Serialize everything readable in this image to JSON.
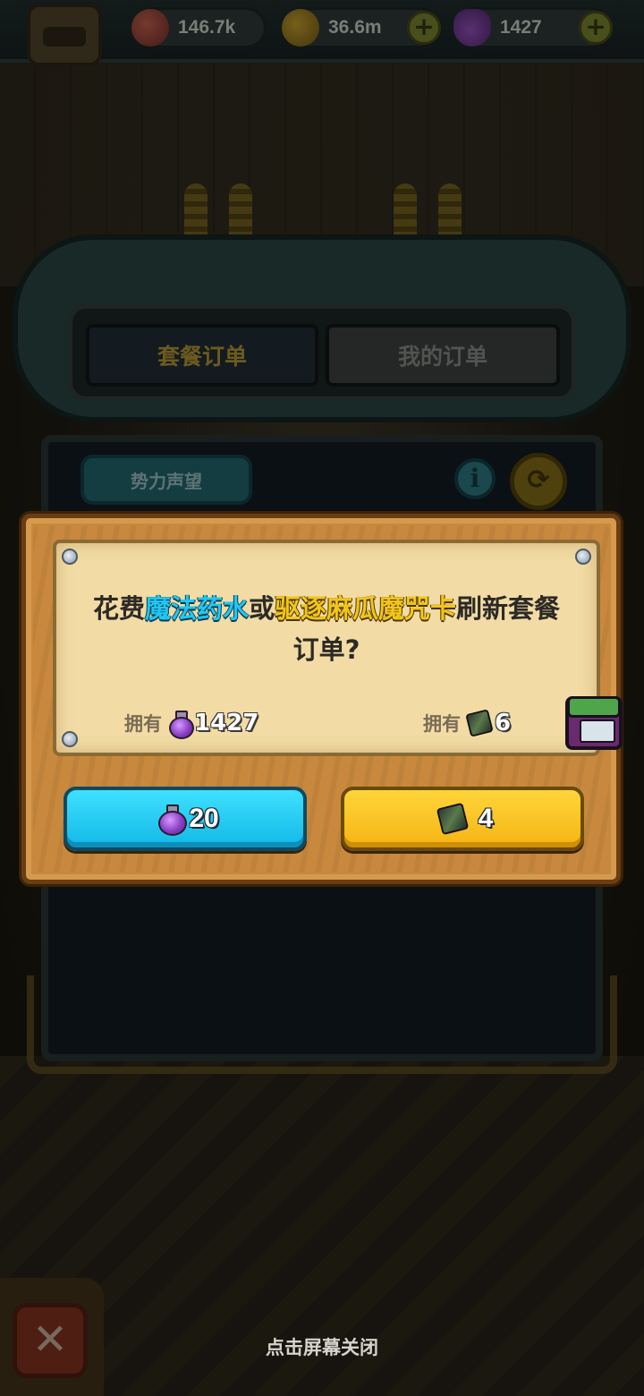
{
  "topbar": {
    "gems": "146.7k",
    "coins": "36.6m",
    "potions": "1427",
    "plus_symbol": "+"
  },
  "tabs": [
    {
      "label": "套餐订单",
      "active": true
    },
    {
      "label": "我的订单",
      "active": false
    }
  ],
  "panel": {
    "faction_button": "势力声望",
    "info_symbol": "i",
    "refresh_symbol": "⟳"
  },
  "dialog": {
    "text_before": "花费",
    "item1": "魔法药水",
    "text_or": "或",
    "item2": "驱逐麻瓜魔咒卡",
    "text_after": "刷新套餐订单?",
    "own_label": "拥有",
    "own_potions": "1427",
    "own_cards": "6",
    "potion_cost": "20",
    "card_cost": "4"
  },
  "footer": {
    "hint": "点击屏幕关闭",
    "close_symbol": "✕"
  },
  "colors": {
    "blue_highlight": "#21c6f2",
    "yellow_highlight": "#f2c51a",
    "potion_button": "#12b8e6",
    "card_button": "#f5b414"
  },
  "icons": [
    "gem-icon",
    "coin-icon",
    "potion-icon",
    "spell-card-icon",
    "info-icon",
    "refresh-icon",
    "close-icon",
    "chest-icon"
  ]
}
